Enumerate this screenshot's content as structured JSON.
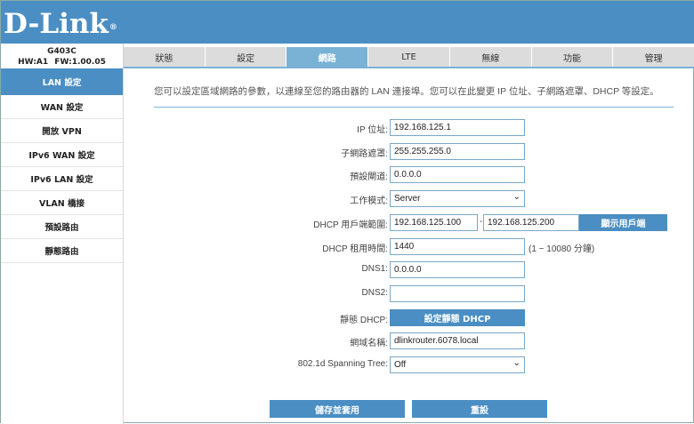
{
  "brand": {
    "logo_text": "D-Link",
    "reg": "®"
  },
  "device": {
    "model": "G403C",
    "hw": "HW:A1",
    "fw": "FW:1.00.05"
  },
  "tabs": [
    {
      "label": "狀態"
    },
    {
      "label": "設定"
    },
    {
      "label": "網路",
      "active": true
    },
    {
      "label": "LTE"
    },
    {
      "label": "無線"
    },
    {
      "label": "功能"
    },
    {
      "label": "管理"
    }
  ],
  "sidebar": {
    "items": [
      {
        "label": "LAN 設定",
        "active": true
      },
      {
        "label": "WAN 設定"
      },
      {
        "label": "開放 VPN"
      },
      {
        "label": "IPv6 WAN 設定"
      },
      {
        "label": "IPv6 LAN 設定"
      },
      {
        "label": "VLAN 橋接"
      },
      {
        "label": "預設路由"
      },
      {
        "label": "靜態路由"
      }
    ]
  },
  "main": {
    "description": "您可以設定區域網路的參數，以連線至您的路由器的 LAN 連接埠。您可以在此變更 IP 位址、子網路遮罩、DHCP 等設定。",
    "ip": {
      "label": "IP 位址:",
      "value": "192.168.125.1"
    },
    "subnet": {
      "label": "子網路遮罩:",
      "value": "255.255.255.0"
    },
    "gateway": {
      "label": "預設閘道:",
      "value": "0.0.0.0"
    },
    "mode": {
      "label": "工作模式:",
      "value": "Server"
    },
    "dhcp_range": {
      "label": "DHCP 用戶端範圍:",
      "start": "192.168.125.100",
      "sep": "-",
      "end": "192.168.125.200",
      "button": "顯示用戶端"
    },
    "lease": {
      "label": "DHCP 租用時間:",
      "value": "1440",
      "note": "(1 ~ 10080 分鐘)"
    },
    "dns1": {
      "label": "DNS1:",
      "value": "0.0.0.0"
    },
    "dns2": {
      "label": "DNS2:",
      "value": ""
    },
    "static_dhcp": {
      "label": "靜態 DHCP:",
      "button": "設定靜態 DHCP"
    },
    "domain": {
      "label": "網域名稱:",
      "value": "dlinkrouter.6078.local"
    },
    "stp": {
      "label": "802.1d Spanning Tree:",
      "value": "Off"
    },
    "save_button": "儲存並套用",
    "reset_button": "重設"
  },
  "colors": {
    "header": "#4a8ec3",
    "tab_active": "#7ab2d6",
    "tab_inactive": "#dcdcdc",
    "button": "#4a8ec3"
  }
}
